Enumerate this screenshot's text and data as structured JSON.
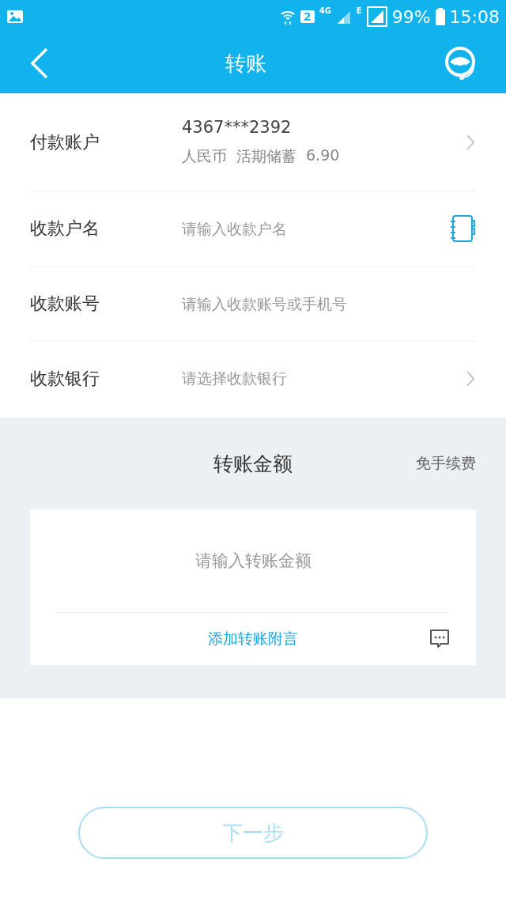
{
  "status_bar": {
    "sim": "2",
    "network": "4G",
    "network_2": "E",
    "battery": "99%",
    "time": "15:08"
  },
  "header": {
    "title": "转账"
  },
  "form": {
    "rows": [
      {
        "kind": "account",
        "label": "付款账户",
        "account": "4367***2392",
        "currency": "人民币",
        "type": "活期储蓄",
        "balance": "6.90"
      },
      {
        "kind": "input",
        "label": "收款户名",
        "placeholder": "请输入收款户名",
        "contacts": true
      },
      {
        "kind": "input",
        "label": "收款账号",
        "placeholder": "请输入收款账号或手机号",
        "contacts": false
      },
      {
        "kind": "select",
        "label": "收款银行",
        "placeholder": "请选择收款银行"
      }
    ]
  },
  "amount": {
    "title": "转账金额",
    "fee_note": "免手续费",
    "placeholder": "请输入转账金额",
    "memo_link": "添加转账附言"
  },
  "next_button": {
    "label": "下一步",
    "disabled": true
  }
}
